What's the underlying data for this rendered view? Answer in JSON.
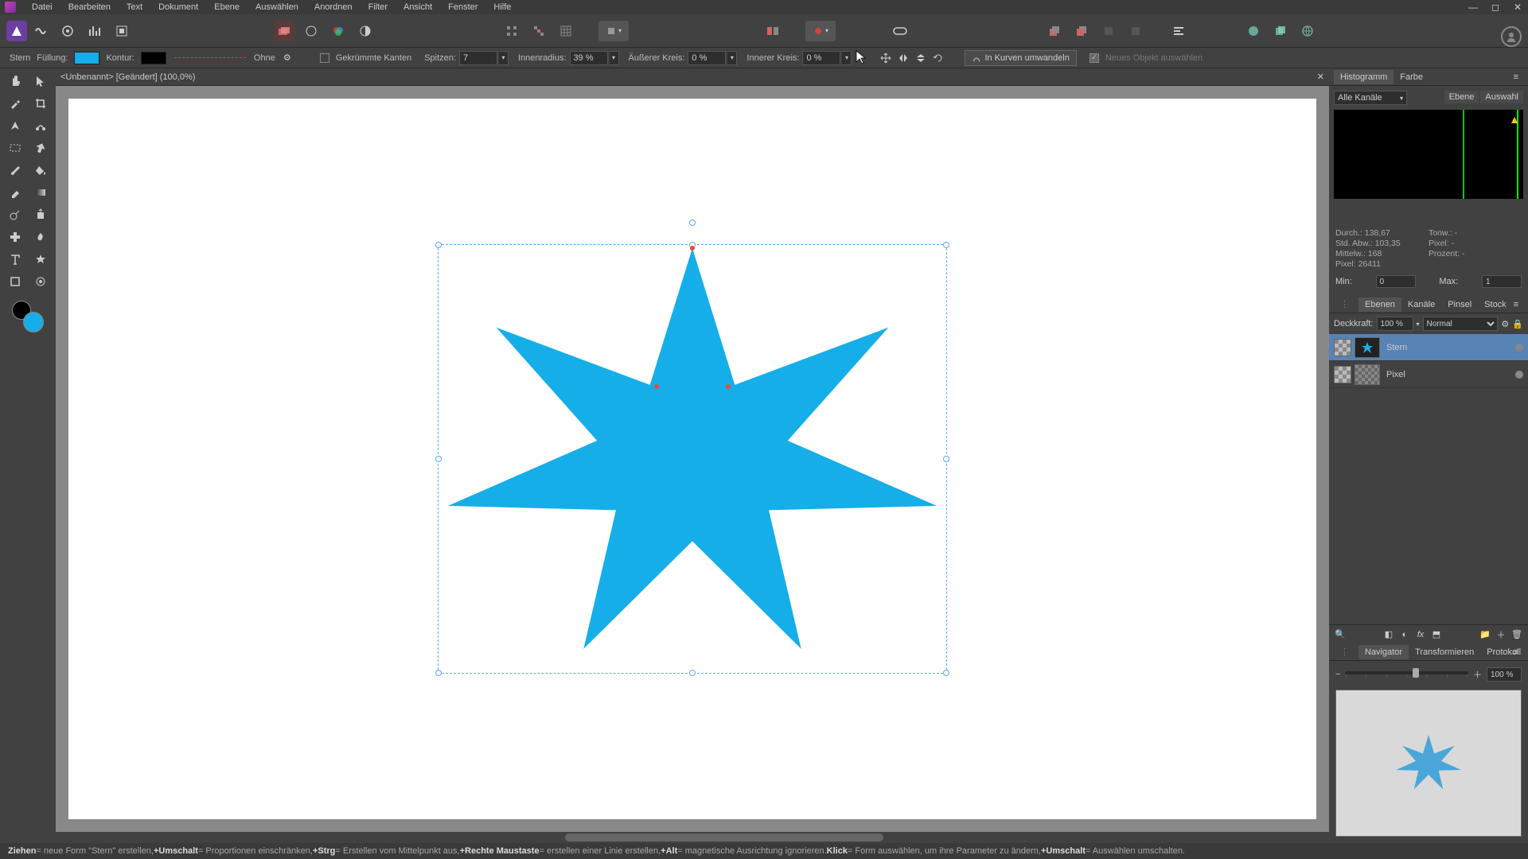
{
  "menu": {
    "items": [
      "Datei",
      "Bearbeiten",
      "Text",
      "Dokument",
      "Ebene",
      "Auswählen",
      "Anordnen",
      "Filter",
      "Ansicht",
      "Fenster",
      "Hilfe"
    ]
  },
  "context": {
    "tool": "Stern",
    "fill_label": "Füllung:",
    "fill_color": "#15aee8",
    "stroke_label": "Kontur:",
    "stroke_color": "#000000",
    "stroke_style": "Ohne",
    "curved_edges": "Gekrümmte Kanten",
    "points_label": "Spitzen:",
    "points": "7",
    "inner_radius_label": "Innenradius:",
    "inner_radius": "39 %",
    "outer_circle_label": "Äußerer Kreis:",
    "outer_circle": "0 %",
    "inner_circle_label": "Innerer Kreis:",
    "inner_circle": "0 %",
    "convert": "In Kurven umwandeln",
    "new_object": "Neues Objekt auswählen"
  },
  "document": {
    "tab": "<Unbenannt> [Geändert] (100,0%)"
  },
  "histogram": {
    "tabs": [
      "Histogramm",
      "Farbe"
    ],
    "channels": "Alle Kanäle",
    "btn_layer": "Ebene",
    "btn_sel": "Auswahl",
    "stats": {
      "durch": "Durch.: 138,67",
      "tonw": "Tonw.: -",
      "stdabw": "Std. Abw.: 103,35",
      "pixel2": "Pixel: -",
      "mittelw": "Mittelw.: 168",
      "prozent": "Prozent: -",
      "pixel": "Pixel: 26411"
    },
    "min_label": "Min:",
    "min": "0",
    "max_label": "Max:",
    "max": "1"
  },
  "layers": {
    "tabs": [
      "Ebenen",
      "Kanäle",
      "Pinsel",
      "Stock"
    ],
    "opacity_label": "Deckkraft:",
    "opacity": "100 %",
    "blend": "Normal",
    "items": [
      {
        "name": "Stern",
        "selected": true,
        "star": true
      },
      {
        "name": "Pixel",
        "selected": false,
        "star": false
      }
    ]
  },
  "navigator": {
    "tabs": [
      "Navigator",
      "Transformieren",
      "Protokoll"
    ],
    "zoom": "100 %"
  },
  "status": {
    "drag_k": "Ziehen",
    "drag_v": " = neue Form \"Stern\" erstellen, ",
    "shift_k": "+Umschalt",
    "shift_v": " = Proportionen einschränken, ",
    "ctrl_k": "+Strg",
    "ctrl_v": " = Erstellen vom Mittelpunkt aus, ",
    "rmb_k": "+Rechte Maustaste",
    "rmb_v": " = erstellen einer Linie erstellen, ",
    "alt_k": "+Alt",
    "alt_v": " = magnetische Ausrichtung ignorieren. ",
    "click_k": "Klick",
    "click_v": " = Form auswählen, um ihre Parameter zu ändern, ",
    "shift2_k": "+Umschalt",
    "shift2_v": " = Auswählen umschalten."
  },
  "chart_data": {
    "type": "shape",
    "shape": "star",
    "points": 7,
    "inner_radius_pct": 39,
    "outer_circle_pct": 0,
    "inner_circle_pct": 0,
    "fill": "#15aee8",
    "stroke": "none"
  }
}
